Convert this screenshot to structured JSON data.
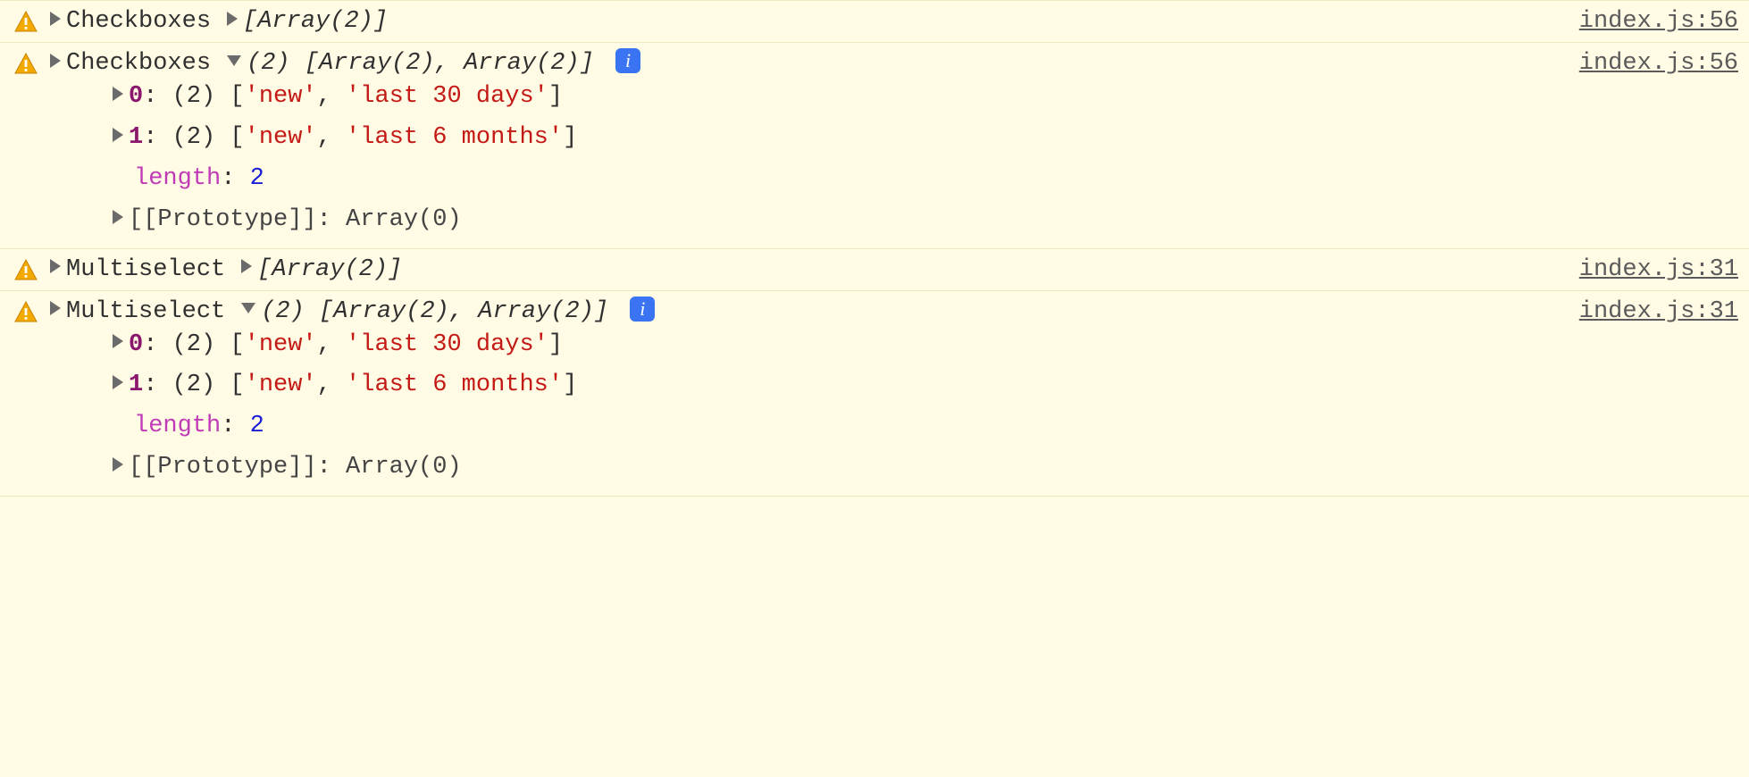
{
  "messages": [
    {
      "label": "Checkboxes",
      "summary": "[Array(2)]",
      "source": "index.js:56",
      "expanded": false
    },
    {
      "label": "Checkboxes",
      "summary_count": "(2)",
      "summary_body": "[Array(2), Array(2)]",
      "source": "index.js:56",
      "expanded": true,
      "rows": {
        "r0_idx": "0",
        "r0_count": "(2)",
        "r0_open": "[",
        "r0_s0": "'new'",
        "r0_sep": ", ",
        "r0_s1": "'last 30 days'",
        "r0_close": "]",
        "r1_idx": "1",
        "r1_count": "(2)",
        "r1_open": "[",
        "r1_s0": "'new'",
        "r1_sep": ", ",
        "r1_s1": "'last 6 months'",
        "r1_close": "]",
        "len_key": "length",
        "len_colon": ": ",
        "len_val": "2",
        "proto_label": "[[Prototype]]",
        "proto_rest": ": Array(0)"
      }
    },
    {
      "label": "Multiselect",
      "summary": "[Array(2)]",
      "source": "index.js:31",
      "expanded": false
    },
    {
      "label": "Multiselect",
      "summary_count": "(2)",
      "summary_body": "[Array(2), Array(2)]",
      "source": "index.js:31",
      "expanded": true,
      "rows": {
        "r0_idx": "0",
        "r0_count": "(2)",
        "r0_open": "[",
        "r0_s0": "'new'",
        "r0_sep": ", ",
        "r0_s1": "'last 30 days'",
        "r0_close": "]",
        "r1_idx": "1",
        "r1_count": "(2)",
        "r1_open": "[",
        "r1_s0": "'new'",
        "r1_sep": ", ",
        "r1_s1": "'last 6 months'",
        "r1_close": "]",
        "len_key": "length",
        "len_colon": ": ",
        "len_val": "2",
        "proto_label": "[[Prototype]]",
        "proto_rest": ": Array(0)"
      }
    }
  ],
  "info_glyph": "i"
}
